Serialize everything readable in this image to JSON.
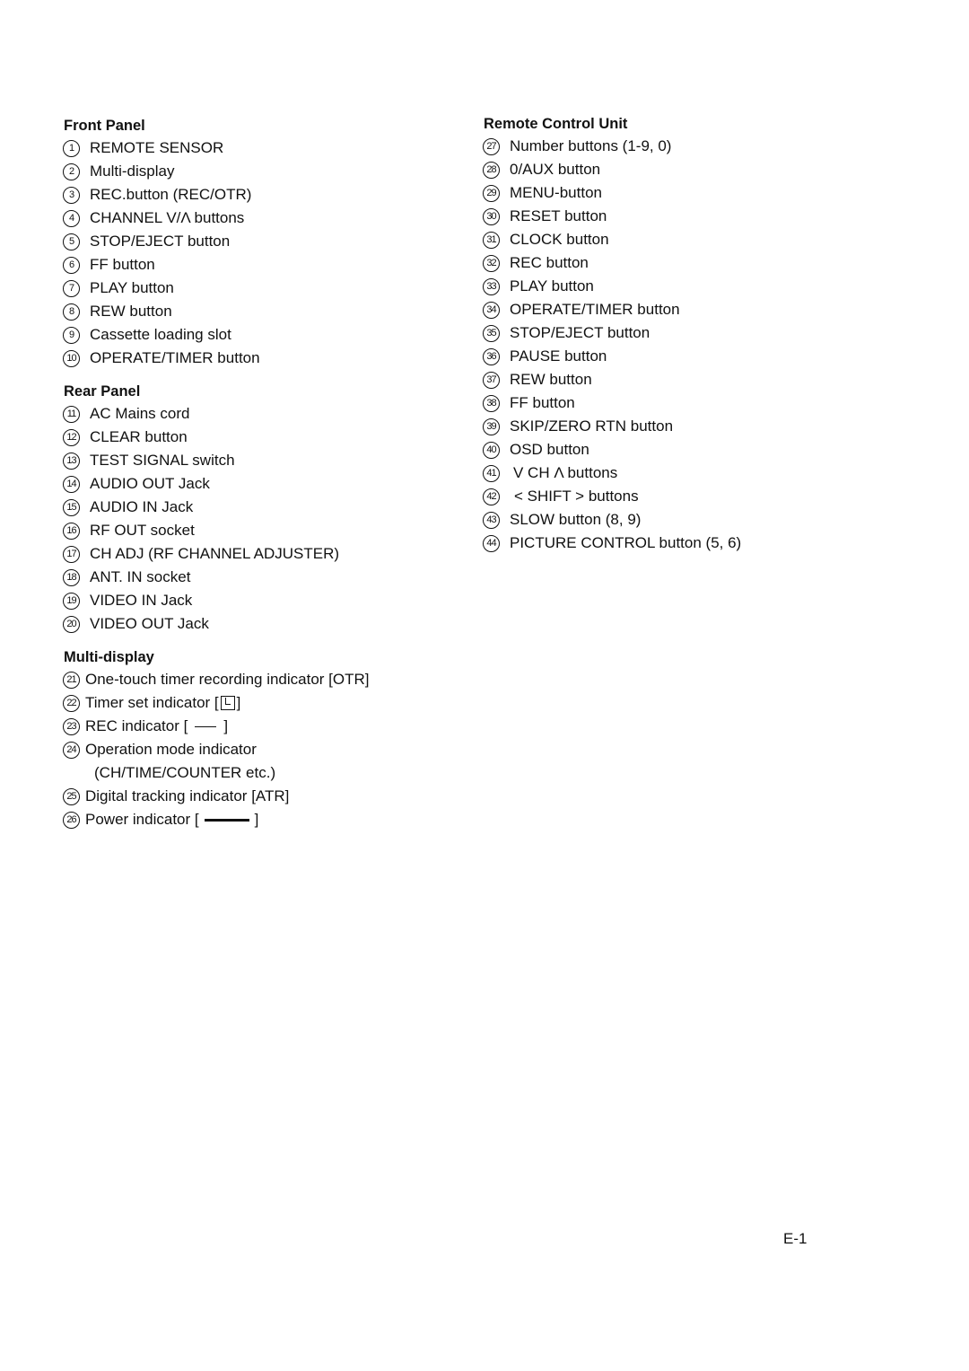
{
  "front_panel": {
    "heading": "Front Panel",
    "items": [
      {
        "n": "1",
        "label": "REMOTE SENSOR"
      },
      {
        "n": "2",
        "label": "Multi-display"
      },
      {
        "n": "3",
        "label": "REC.button (REC/OTR)"
      },
      {
        "n": "4",
        "label": "CHANNEL V/Λ buttons"
      },
      {
        "n": "5",
        "label": "STOP/EJECT button"
      },
      {
        "n": "6",
        "label": "FF button"
      },
      {
        "n": "7",
        "label": "PLAY button"
      },
      {
        "n": "8",
        "label": "REW button"
      },
      {
        "n": "9",
        "label": "Cassette loading slot"
      },
      {
        "n": "10",
        "label": "OPERATE/TIMER button"
      }
    ]
  },
  "rear_panel": {
    "heading": "Rear Panel",
    "items": [
      {
        "n": "11",
        "label": "AC Mains cord"
      },
      {
        "n": "12",
        "label": "CLEAR button"
      },
      {
        "n": "13",
        "label": "TEST SIGNAL switch"
      },
      {
        "n": "14",
        "label": "AUDIO OUT Jack"
      },
      {
        "n": "15",
        "label": "AUDIO IN Jack"
      },
      {
        "n": "16",
        "label": "RF OUT socket"
      },
      {
        "n": "17",
        "label": "CH ADJ (RF CHANNEL ADJUSTER)"
      },
      {
        "n": "18",
        "label": "ANT. IN socket"
      },
      {
        "n": "19",
        "label": "VIDEO IN Jack"
      },
      {
        "n": "20",
        "label": "VIDEO OUT Jack"
      }
    ]
  },
  "multi_display": {
    "heading": "Multi-display",
    "items": [
      {
        "n": "21",
        "label": "One-touch timer recording indicator [OTR]"
      },
      {
        "n": "22",
        "label": "Timer set indicator [",
        "suffix": "]"
      },
      {
        "n": "23",
        "label": "REC indicator [",
        "suffix": "]"
      },
      {
        "n": "24",
        "label": "Operation mode indicator",
        "cont": "(CH/TIME/COUNTER etc.)"
      },
      {
        "n": "25",
        "label": "Digital tracking indicator [ATR]"
      },
      {
        "n": "26",
        "label": "Power indicator [",
        "suffix": "]"
      }
    ]
  },
  "remote_control": {
    "heading": "Remote Control Unit",
    "items": [
      {
        "n": "27",
        "label": "Number buttons (1-9, 0)"
      },
      {
        "n": "28",
        "label": "0/AUX button"
      },
      {
        "n": "29",
        "label": "MENU-button"
      },
      {
        "n": "30",
        "label": "RESET button"
      },
      {
        "n": "31",
        "label": "CLOCK button"
      },
      {
        "n": "32",
        "label": "REC button"
      },
      {
        "n": "33",
        "label": "PLAY button"
      },
      {
        "n": "34",
        "label": "OPERATE/TIMER button"
      },
      {
        "n": "35",
        "label": "STOP/EJECT button"
      },
      {
        "n": "36",
        "label": "PAUSE button"
      },
      {
        "n": "37",
        "label": "REW button"
      },
      {
        "n": "38",
        "label": "FF button"
      },
      {
        "n": "39",
        "label": "SKIP/ZERO RTN button"
      },
      {
        "n": "40",
        "label": "OSD button"
      },
      {
        "n": "41",
        "label": "V CH Λ  buttons"
      },
      {
        "n": "42",
        "label": "< SHIFT > buttons"
      },
      {
        "n": "43",
        "label": "SLOW button (8, 9)"
      },
      {
        "n": "44",
        "label": "PICTURE CONTROL button (5, 6)"
      }
    ]
  },
  "page_number": "E-1"
}
